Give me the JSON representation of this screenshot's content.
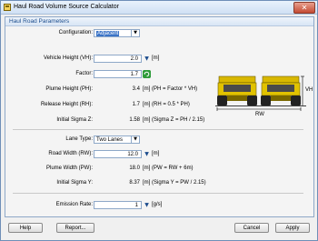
{
  "window": {
    "title": "Haul Road Volume Source Calculator",
    "close_symbol": "✕"
  },
  "panel": {
    "title": "Haul Road Parameters"
  },
  "configuration": {
    "label": "Configuration:",
    "value": "Adjacent"
  },
  "vehicle_height": {
    "label": "Vehicle Height (VH):",
    "value": "2.0",
    "unit": "[m]"
  },
  "factor": {
    "label": "Factor:",
    "value": "1.7"
  },
  "plume_height": {
    "label": "Plume Height (PH):",
    "value": "3.4",
    "formula": "[m] (PH = Factor * VH)"
  },
  "release_height": {
    "label": "Release Height (RH):",
    "value": "1.7",
    "formula": "[m] (RH = 0.5 * PH)"
  },
  "initial_sigma_z": {
    "label": "Initial Sigma Z:",
    "value": "1.58",
    "formula": "[m] (Sigma Z = PH / 2.15)"
  },
  "lane_type": {
    "label": "Lane Type:",
    "value": "Two Lanes"
  },
  "road_width": {
    "label": "Road Width (RW):",
    "value": "12.0",
    "unit": "[m]"
  },
  "plume_width": {
    "label": "Plume Width (PW):",
    "value": "18.0",
    "formula": "[m] (PW = RW + 6m)"
  },
  "initial_sigma_y": {
    "label": "Initial Sigma Y:",
    "value": "8.37",
    "formula": "[m] (Sigma Y = PW / 2.15)"
  },
  "emission_rate": {
    "label": "Emission Rate:",
    "value": "1",
    "unit": "[g/s]"
  },
  "diagram": {
    "vh_label": "VH",
    "rw_label": "RW"
  },
  "buttons": {
    "help": "Help",
    "report": "Report...",
    "cancel": "Cancel",
    "apply": "Apply"
  },
  "icons": {
    "spin": "▼",
    "dropdown": "▼",
    "refresh": "refresh-icon"
  },
  "colors": {
    "accent": "#1a4b8c",
    "selection": "#3b74c7",
    "truck_body": "#d9b800",
    "refresh": "#2e9b3a"
  }
}
